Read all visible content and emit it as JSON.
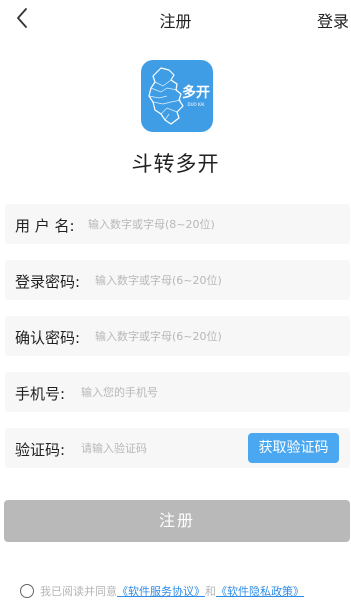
{
  "nav": {
    "title": "注册",
    "login_label": "登录"
  },
  "app": {
    "name": "斗转多开",
    "logo_title": "多开",
    "logo_subtitle": "DUO KAI",
    "logo_color": "#3f9de6"
  },
  "form": {
    "username": {
      "label": "用 户 名:",
      "placeholder": "输入数字或字母(8~20位)",
      "value": ""
    },
    "password": {
      "label": "登录密码:",
      "placeholder": "输入数字或字母(6~20位)",
      "value": ""
    },
    "confirm": {
      "label": "确认密码:",
      "placeholder": "输入数字或字母(6~20位)",
      "value": ""
    },
    "phone": {
      "label": "手机号:",
      "placeholder": "输入您的手机号",
      "value": ""
    },
    "code": {
      "label": "验证码:",
      "placeholder": "请输入验证码",
      "value": "",
      "button_label": "获取验证码"
    }
  },
  "submit_label": "注册",
  "agreement": {
    "prefix": "我已阅读并同意",
    "service_link": "《软件服务协议》",
    "middle": "和",
    "privacy_link": "《软件隐私政策》",
    "checked": false
  },
  "colors": {
    "accent": "#4ba8f0",
    "submit_disabled": "#b9b9b9",
    "link": "#2e8ce6"
  }
}
